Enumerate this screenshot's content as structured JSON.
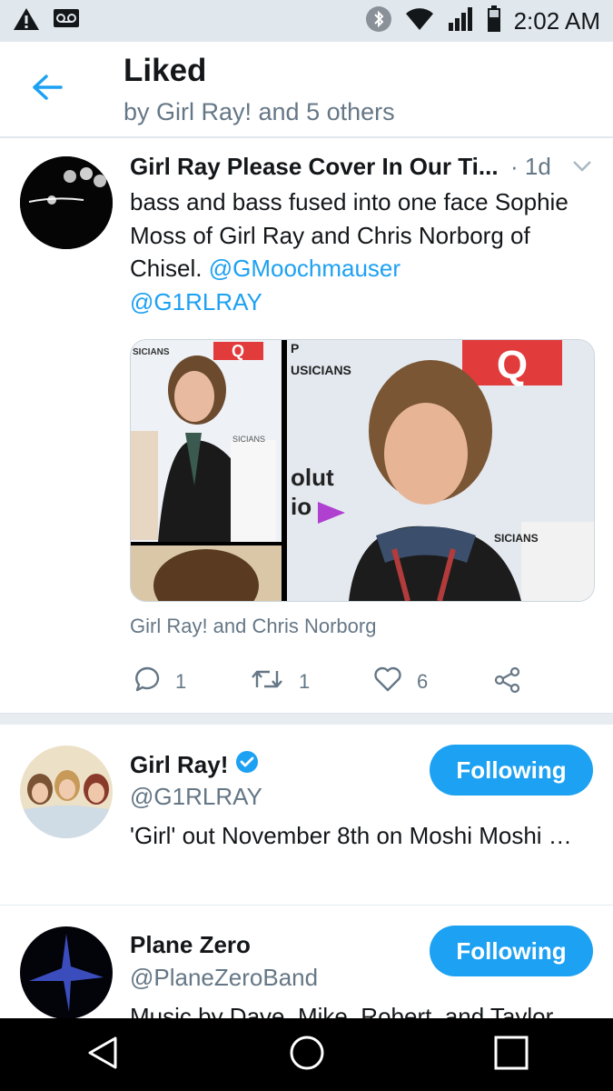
{
  "status_bar": {
    "time": "2:02 AM",
    "icons": [
      "warning-icon",
      "voicemail-icon",
      "bluetooth-icon",
      "wifi-icon",
      "signal-icon",
      "battery-icon"
    ]
  },
  "header": {
    "title": "Liked",
    "subtitle": "by Girl Ray! and 5 others"
  },
  "tweet": {
    "author_name": "Girl Ray Please Cover In Our Ti...",
    "time": "· 1d",
    "text_plain": "bass and bass fused into one face Sophie Moss of Girl Ray and Chris Norborg of Chisel. ",
    "mention_1": "@GMoochmauser",
    "mention_2": "@G1RLRAY",
    "media_caption": "Girl Ray! and Chris Norborg",
    "media_signs": {
      "q_logo": "Q",
      "sign_a": "SICIANS",
      "sign_b": "P",
      "sign_c": "USICIANS",
      "sign_d": "olut",
      "sign_e": "io",
      "sign_f": "SICIANS"
    },
    "reply_count": "1",
    "retweet_count": "1",
    "like_count": "6"
  },
  "users": [
    {
      "name": "Girl Ray!",
      "handle": "@G1RLRAY",
      "verified": true,
      "bio": "'Girl' out November 8th on Moshi Moshi …",
      "button_label": "Following"
    },
    {
      "name": "Plane Zero",
      "handle": "@PlaneZeroBand",
      "verified": false,
      "bio": "Music by Dave, Mike, Robert, and Taylor",
      "button_label": "Following"
    }
  ],
  "colors": {
    "accent": "#1da1f2",
    "secondary_text": "#657786",
    "status_bar_bg": "#e1e8ed",
    "nav_bar_bg": "#000000"
  }
}
